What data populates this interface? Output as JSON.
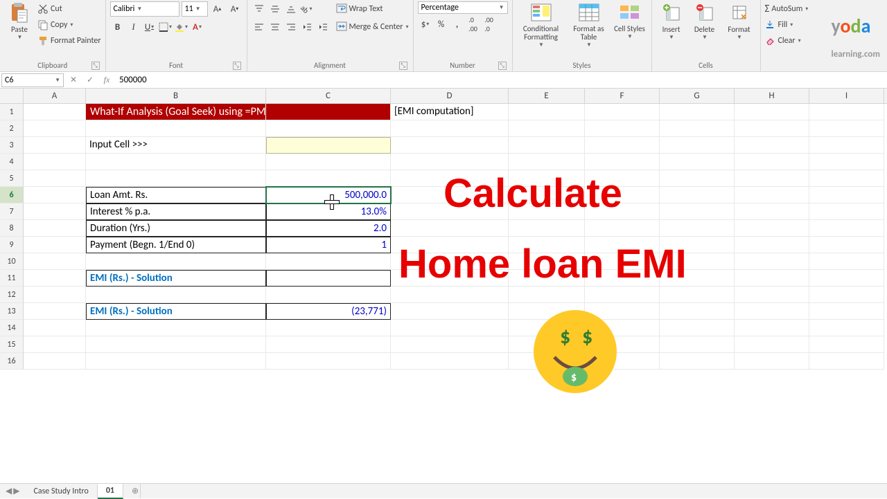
{
  "ribbon": {
    "clipboard": {
      "paste": "Paste",
      "cut": "Cut",
      "copy": "Copy",
      "painter": "Format Painter",
      "label": "Clipboard"
    },
    "font": {
      "name": "Calibri",
      "size": "11",
      "label": "Font"
    },
    "alignment": {
      "wrap": "Wrap Text",
      "merge": "Merge & Center",
      "label": "Alignment"
    },
    "number": {
      "format": "Percentage",
      "label": "Number"
    },
    "styles": {
      "cond": "Conditional Formatting",
      "table": "Format as Table",
      "cell": "Cell Styles",
      "label": "Styles"
    },
    "cells": {
      "insert": "Insert",
      "delete": "Delete",
      "format": "Format",
      "label": "Cells"
    },
    "editing": {
      "autosum": "AutoSum",
      "fill": "Fill",
      "clear": "Clear"
    }
  },
  "formula_bar": {
    "cell_ref": "C6",
    "value": "500000"
  },
  "columns": [
    "A",
    "B",
    "C",
    "D",
    "E",
    "F",
    "G",
    "H",
    "I"
  ],
  "col_widths": {
    "A": 90,
    "B": 260,
    "C": 180,
    "D": 170,
    "E": 110,
    "F": 108,
    "G": 108,
    "H": 108,
    "I": 108
  },
  "rows_count": 16,
  "content": {
    "title": "What-If Analysis (Goal Seek) using =PMT()",
    "subtitle": "[EMI computation]",
    "input_label": "Input Cell >>>",
    "loan_label": "Loan Amt. Rs.",
    "loan_val": "500,000.0",
    "rate_label": "Interest % p.a.",
    "rate_val": "13.0%",
    "dur_label": "Duration (Yrs.)",
    "dur_val": "2.0",
    "pay_label": "Payment (Begn. 1/End 0)",
    "pay_val": "1",
    "emi1_label": "EMI (Rs.) - Solution",
    "emi1_val": "",
    "emi2_label": "EMI (Rs.) - Solution",
    "emi2_val": "(23,771)"
  },
  "overlay": {
    "line1": "Calculate",
    "line2": "Home loan EMI"
  },
  "tabs": {
    "t1": "Case Study Intro",
    "t2": "01"
  },
  "watermark": {
    "text": "yoda",
    "sub": "learning.com"
  }
}
